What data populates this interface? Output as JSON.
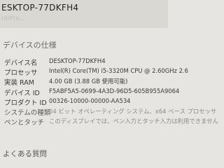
{
  "header": {
    "title": "ESKTOP-77DKFH4",
    "subtitle": "ntiPro..."
  },
  "section_title": "デバイスの仕様",
  "specs": [
    {
      "label": "デバイス名",
      "value": "DESKTOP-77DKFH4"
    },
    {
      "label": "プロセッサ",
      "value": "Intel(R) Core(TM) i5-3320M CPU @ 2.60GHz 2.6"
    },
    {
      "label": "実装 RAM",
      "value": "4.00 GB (3.88 GB 使用可能)"
    },
    {
      "label": "デバイス ID",
      "value": "F5ABF5A5-0699-4A3D-96D5-605B955A9064"
    },
    {
      "label": "プロダクト ID",
      "value": "00326-10000-00000-AA534"
    },
    {
      "label": "システムの種類",
      "value": "64 ビット オペレーティング システム、x64 ベース プロセッサ"
    },
    {
      "label": "ペンとタッチ",
      "value": "このディスプレイでは、ペン入力とタッチ入力は利用できません"
    }
  ],
  "faq_label": "よくある質問"
}
